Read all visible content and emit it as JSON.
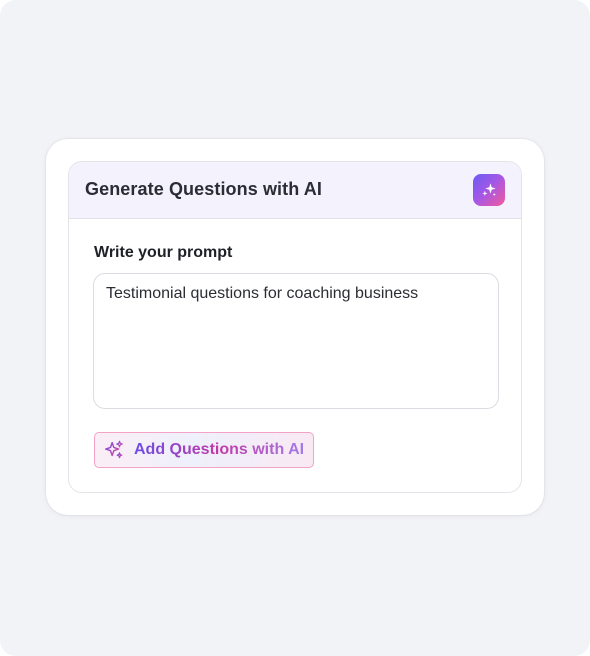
{
  "panel": {
    "title": "Generate Questions with AI",
    "badge_icon": "sparkles-icon"
  },
  "prompt": {
    "label": "Write your prompt",
    "value": "Testimonial questions for coaching business",
    "placeholder": ""
  },
  "action": {
    "label": "Add Questions with AI",
    "icon": "sparkles-icon"
  },
  "colors": {
    "background": "#f2f3f7",
    "header_bg": "#f4f2fd",
    "accent_start": "#6a5cf2",
    "accent_mid": "#a257e8",
    "accent_end": "#f25a9c",
    "button_border": "#f4a2c6"
  }
}
